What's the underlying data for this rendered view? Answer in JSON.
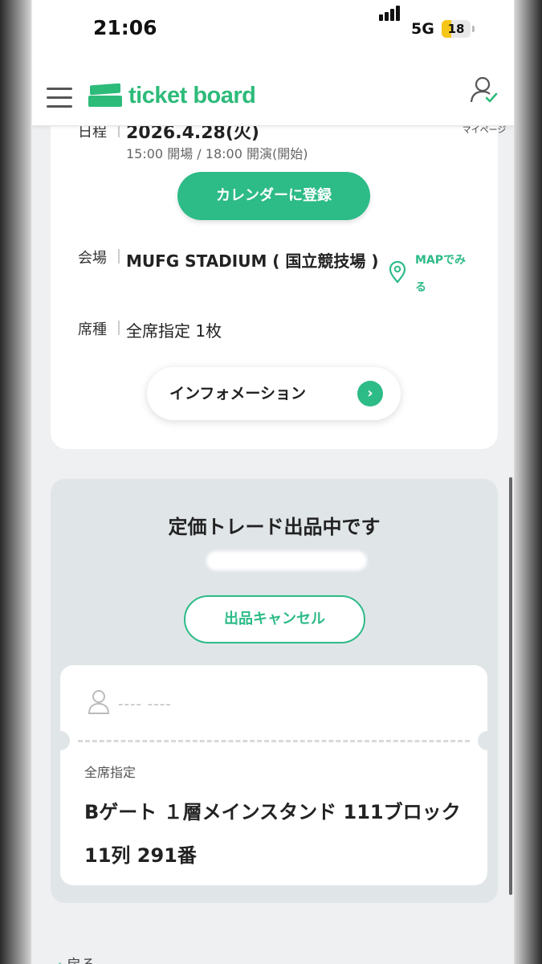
{
  "status_bar": {
    "time": "21:06",
    "network": "5G",
    "battery": "18"
  },
  "header": {
    "logo": "ticket board",
    "mypage_label": "マイページ"
  },
  "event": {
    "date_label": "日程",
    "date": "2026.4.28(火)",
    "times": "15:00 開場 / 18:00 開演(開始)",
    "calendar_button": "カレンダーに登録",
    "venue_label": "会場",
    "venue": "MUFG STADIUM ( 国立競技場 )",
    "map_link": "MAPでみる",
    "seat_label": "席種",
    "seat_type": "全席指定 1枚",
    "info_button": "インフォメーション"
  },
  "trade": {
    "title": "定価トレード出品中です",
    "cancel_button": "出品キャンセル",
    "ticket": {
      "holder": "---- ----",
      "seat_type": "全席指定",
      "seat": "Bゲート １層メインスタンド 111ブロック 11列 291番"
    }
  },
  "footer": {
    "back_label": "戻る"
  },
  "colors": {
    "brand": "#2dbb7a",
    "accent": "#2dbb87"
  }
}
